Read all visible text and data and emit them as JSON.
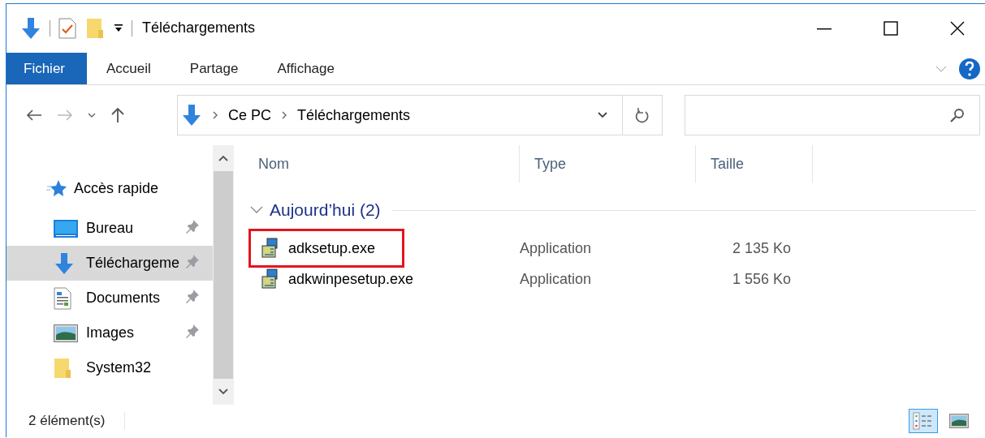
{
  "window": {
    "title": "Téléchargements"
  },
  "ribbon_tabs": [
    {
      "label": "Fichier",
      "selected": true
    },
    {
      "label": "Accueil",
      "selected": false
    },
    {
      "label": "Partage",
      "selected": false
    },
    {
      "label": "Affichage",
      "selected": false
    }
  ],
  "address": {
    "path": [
      "Ce PC",
      "Téléchargements"
    ]
  },
  "sidebar": {
    "header": "Accès rapide",
    "items": [
      {
        "label": "Bureau",
        "kind": "desktop",
        "pinned": true,
        "selected": false
      },
      {
        "label": "Téléchargeme",
        "kind": "downloads",
        "pinned": true,
        "selected": true
      },
      {
        "label": "Documents",
        "kind": "documents",
        "pinned": true,
        "selected": false
      },
      {
        "label": "Images",
        "kind": "pictures",
        "pinned": true,
        "selected": false
      },
      {
        "label": "System32",
        "kind": "folder",
        "pinned": false,
        "selected": false
      }
    ]
  },
  "columns": [
    "Nom",
    "Type",
    "Taille"
  ],
  "group": {
    "label": "Aujourd’hui (2)",
    "expanded": true
  },
  "files": [
    {
      "name": "adksetup.exe",
      "type": "Application",
      "size": "2 135 Ko",
      "highlighted": true
    },
    {
      "name": "adkwinpesetup.exe",
      "type": "Application",
      "size": "1 556 Ko",
      "highlighted": false
    }
  ],
  "status_bar": {
    "count": "2 élément(s)"
  },
  "view_buttons": [
    {
      "kind": "details",
      "selected": true
    },
    {
      "kind": "preview",
      "selected": false
    }
  ]
}
